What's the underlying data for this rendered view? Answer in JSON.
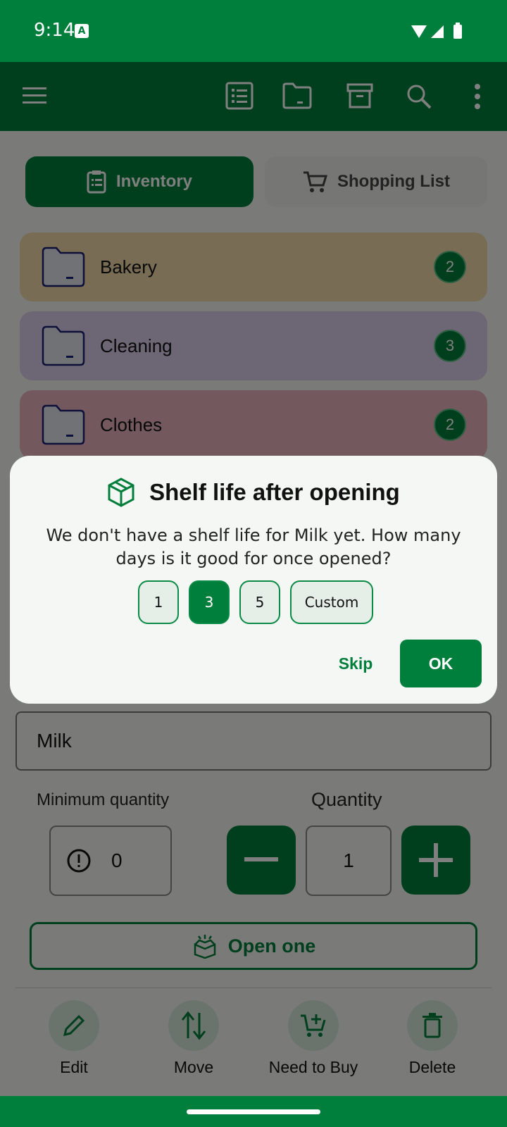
{
  "status": {
    "time": "9:14",
    "notification_icon": "A"
  },
  "toolbar": {
    "icons": [
      "menu-icon",
      "list-icon",
      "folder-icon",
      "archive-icon",
      "search-icon",
      "more-vert-icon"
    ]
  },
  "tabs": [
    {
      "label": "Inventory",
      "selected": true
    },
    {
      "label": "Shopping List",
      "selected": false
    }
  ],
  "categories": [
    {
      "name": "Bakery",
      "count": "2",
      "color": "#f0d9a8"
    },
    {
      "name": "Cleaning",
      "count": "3",
      "color": "#d9cdeb"
    },
    {
      "name": "Clothes",
      "count": "2",
      "color": "#e6b3bd"
    }
  ],
  "item": {
    "name": "Milk",
    "min_quantity_label": "Minimum quantity",
    "min_quantity": "0",
    "quantity_label": "Quantity",
    "quantity": "1",
    "open_one_label": "Open one"
  },
  "actions": [
    {
      "label": "Edit",
      "icon": "pencil-icon"
    },
    {
      "label": "Move",
      "icon": "move-arrows-icon"
    },
    {
      "label": "Need to Buy",
      "icon": "cart-add-icon"
    },
    {
      "label": "Delete",
      "icon": "trash-icon"
    }
  ],
  "dialog": {
    "title": "Shelf life after opening",
    "body": "We don't have a shelf life for Milk yet. How many days is it good for once opened?",
    "options": [
      "1",
      "3",
      "5",
      "Custom"
    ],
    "selected_option": "3",
    "skip_label": "Skip",
    "ok_label": "OK"
  },
  "colors": {
    "primary": "#007e3b",
    "surface": "#f4f7f3"
  }
}
